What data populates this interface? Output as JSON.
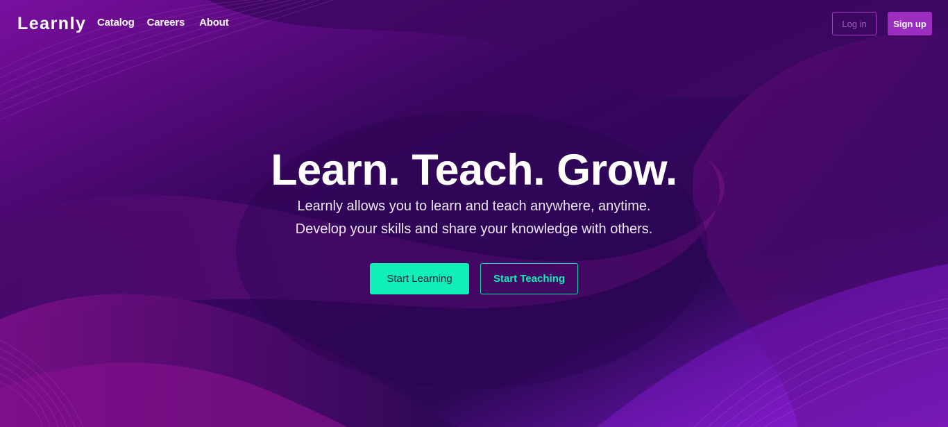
{
  "brand": {
    "name": "Learnly"
  },
  "nav": {
    "links": [
      {
        "label": "Catalog"
      },
      {
        "label": "Careers"
      },
      {
        "label": "About"
      }
    ],
    "login_label": "Log in",
    "signup_label": "Sign up"
  },
  "hero": {
    "title": "Learn. Teach. Grow.",
    "subtitle_line1": "Learnly allows you to learn and teach anywhere, anytime.",
    "subtitle_line2": "Develop your skills and share your knowledge with others.",
    "primary_cta": "Start Learning",
    "secondary_cta": "Start Teaching"
  },
  "colors": {
    "background": "#2a0850",
    "accent": "#12f0b9",
    "brand_purple": "#9b2dbf"
  }
}
